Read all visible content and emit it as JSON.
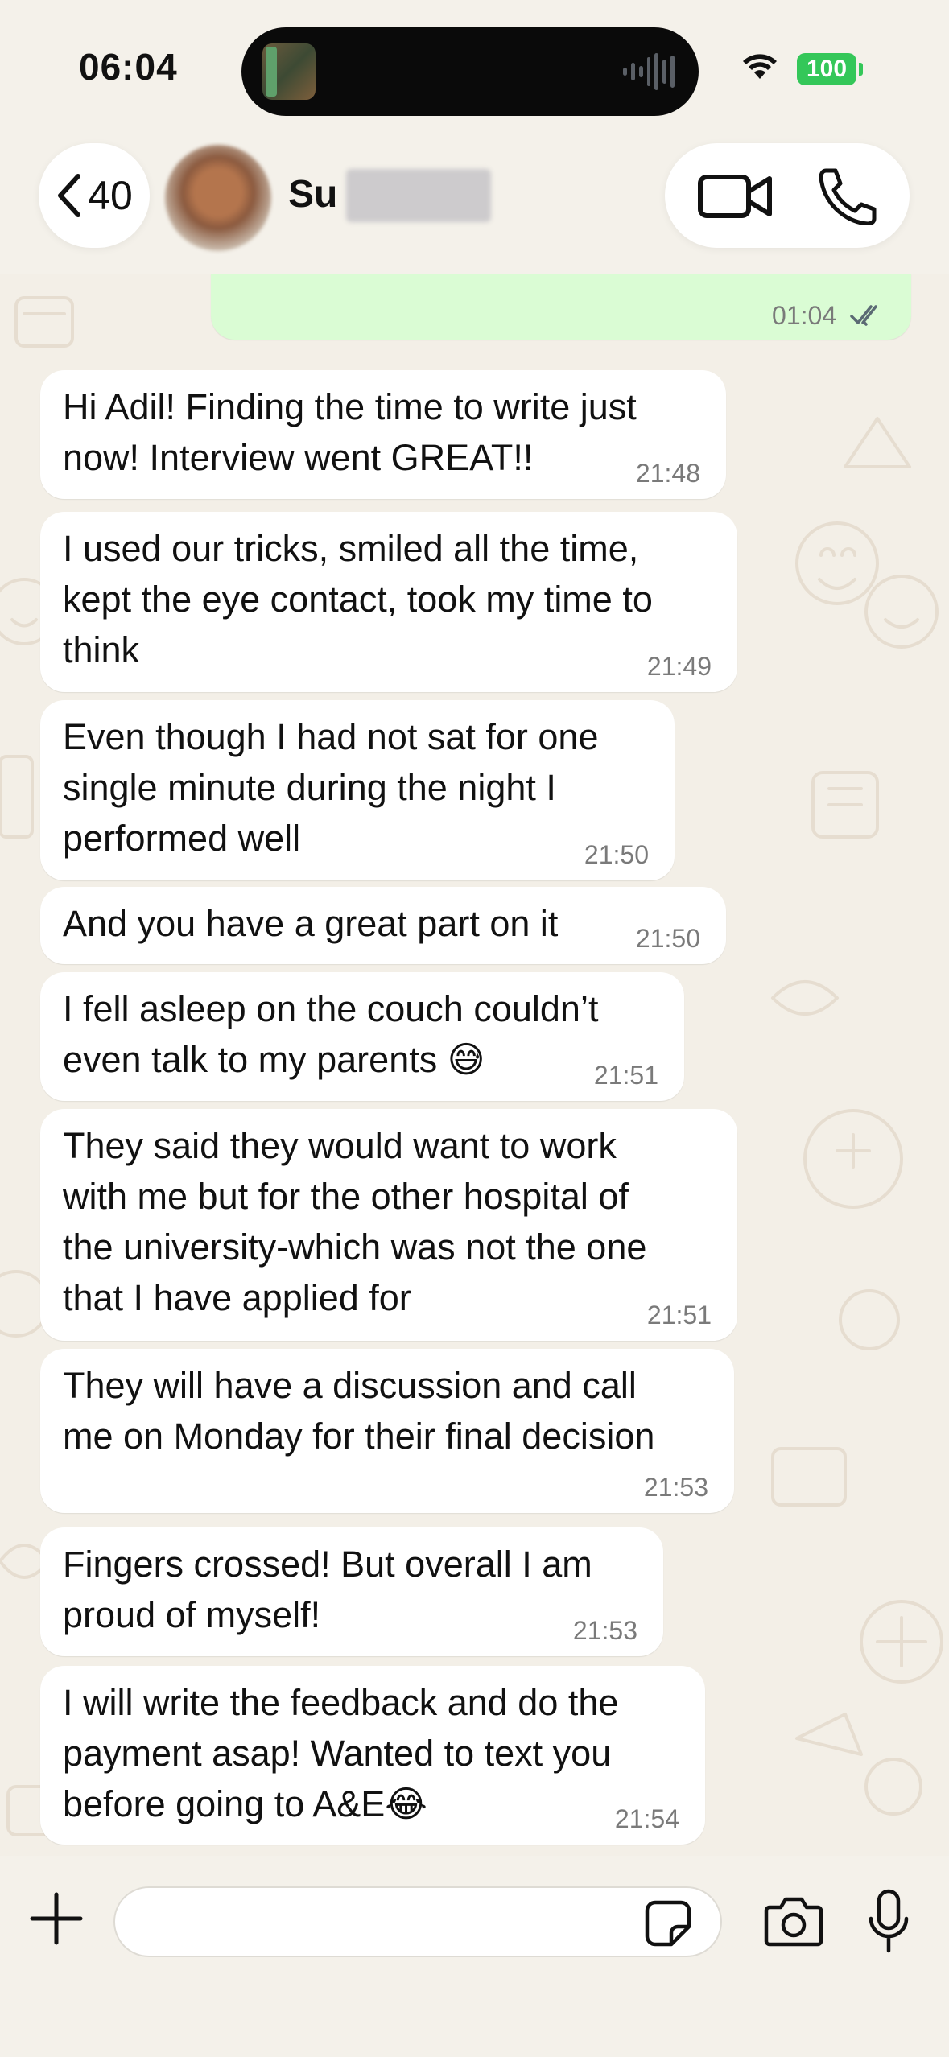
{
  "status_bar": {
    "time": "06:04",
    "battery": "100"
  },
  "header": {
    "back_count": "40",
    "contact_name": "Su"
  },
  "messages": [
    {
      "direction": "outgoing",
      "text": "",
      "time": "01:04",
      "read": true
    },
    {
      "direction": "incoming",
      "text": "Hi Adil! Finding the time to write just\nnow! Interview went GREAT!!",
      "time": "21:48"
    },
    {
      "direction": "incoming",
      "text": "I used our tricks, smiled all the time,\nkept the eye contact, took my time to\nthink",
      "time": "21:49"
    },
    {
      "direction": "incoming",
      "text": "Even though I had not sat for one\nsingle minute during the night I\nperformed well",
      "time": "21:50"
    },
    {
      "direction": "incoming",
      "text": "And you have a great part on it",
      "time": "21:50"
    },
    {
      "direction": "incoming",
      "text": "I fell asleep on the couch couldn’t\neven talk to my parents 😅",
      "time": "21:51"
    },
    {
      "direction": "incoming",
      "text": "They said they would want to work\nwith me but for the other hospital of\nthe university-which was not the one\nthat I have applied for",
      "time": "21:51"
    },
    {
      "direction": "incoming",
      "text": "They will have a discussion and call\nme on Monday for their final decision",
      "time": "21:53"
    },
    {
      "direction": "incoming",
      "text": "Fingers crossed! But overall I am\nproud of myself!",
      "time": "21:53"
    },
    {
      "direction": "incoming",
      "text": "I will write the feedback and do the\npayment asap! Wanted to text you\nbefore going to A&E😂",
      "time": "21:54"
    }
  ],
  "input": {
    "placeholder": ""
  },
  "colors": {
    "incoming_bubble": "#ffffff",
    "outgoing_bubble": "#dafcd4",
    "read_ticks": "#5b6a74",
    "battery": "#34c759"
  },
  "icons": [
    "back-chevron-icon",
    "video-camera-icon",
    "phone-icon",
    "plus-icon",
    "sticker-icon",
    "camera-icon",
    "microphone-icon",
    "wifi-icon",
    "read-ticks-icon"
  ]
}
